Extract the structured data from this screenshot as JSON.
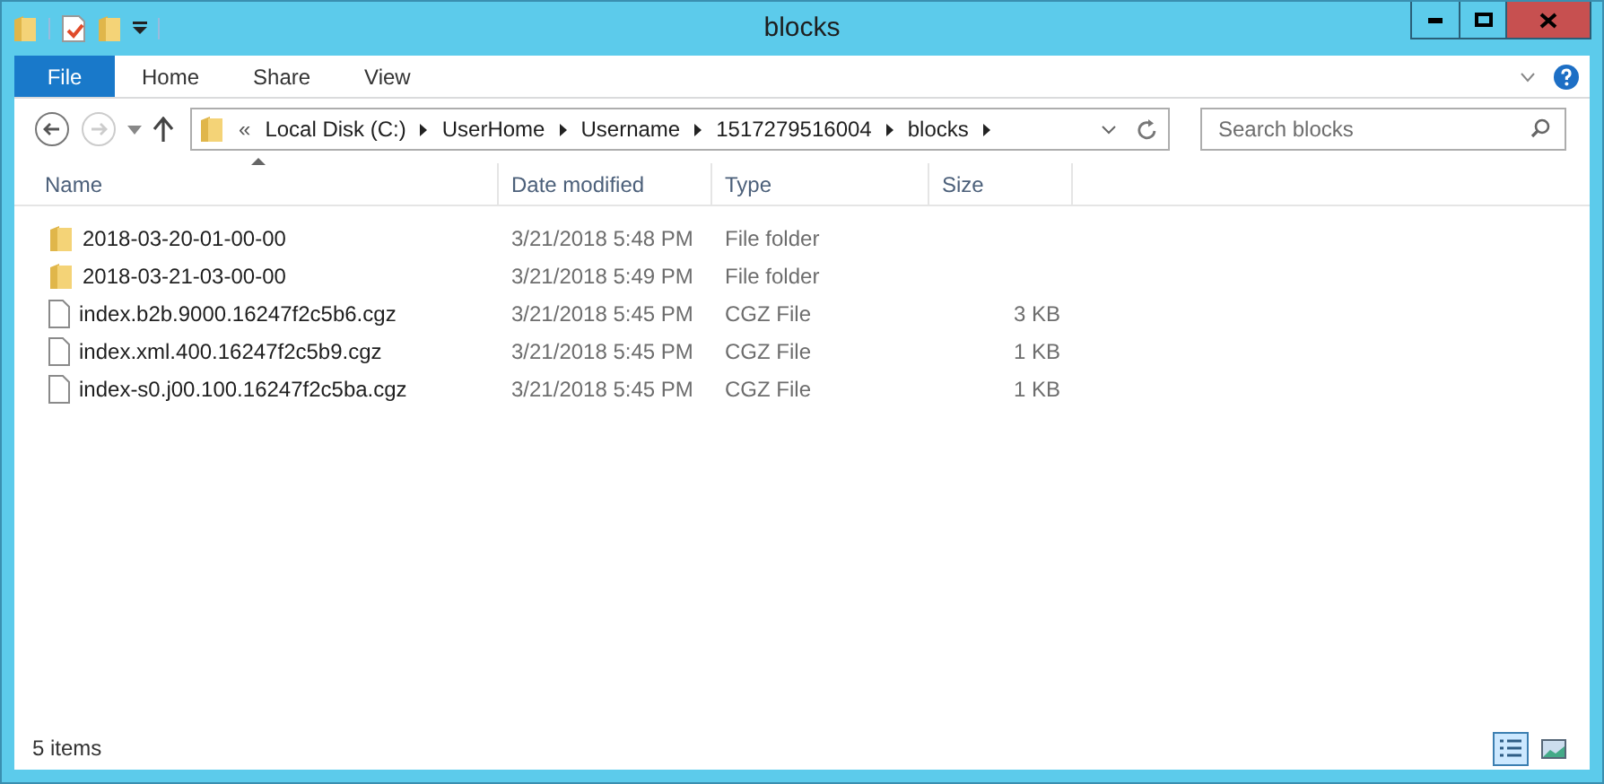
{
  "window": {
    "title": "blocks"
  },
  "ribbon_tabs": [
    {
      "label": "File",
      "kind": "file"
    },
    {
      "label": "Home",
      "kind": "tab"
    },
    {
      "label": "Share",
      "kind": "tab"
    },
    {
      "label": "View",
      "kind": "tab"
    }
  ],
  "address": {
    "overflow": "«",
    "segments": [
      "Local Disk (C:)",
      "UserHome",
      "Username",
      "1517279516004",
      "blocks"
    ]
  },
  "search": {
    "placeholder": "Search blocks"
  },
  "columns": [
    "Name",
    "Date modified",
    "Type",
    "Size"
  ],
  "rows": [
    {
      "kind": "folder",
      "name": "2018-03-20-01-00-00",
      "date": "3/21/2018 5:48 PM",
      "type": "File folder"
    },
    {
      "kind": "folder",
      "name": "2018-03-21-03-00-00",
      "date": "3/21/2018 5:49 PM",
      "type": "File folder"
    },
    {
      "kind": "file",
      "name": "index.b2b.9000.16247f2c5b6.cgz",
      "date": "3/21/2018 5:45 PM",
      "type": "CGZ File",
      "size": "3 KB"
    },
    {
      "kind": "file",
      "name": "index.xml.400.16247f2c5b9.cgz",
      "date": "3/21/2018 5:45 PM",
      "type": "CGZ File",
      "size": "1 KB"
    },
    {
      "kind": "file",
      "name": "index-s0.j00.100.16247f2c5ba.cgz",
      "date": "3/21/2018 5:45 PM",
      "type": "CGZ File",
      "size": "1 KB"
    }
  ],
  "status_bar": {
    "count": "5 items"
  },
  "views": [
    {
      "kind": "details",
      "selected": true
    },
    {
      "kind": "large_icons",
      "selected": false
    }
  ]
}
